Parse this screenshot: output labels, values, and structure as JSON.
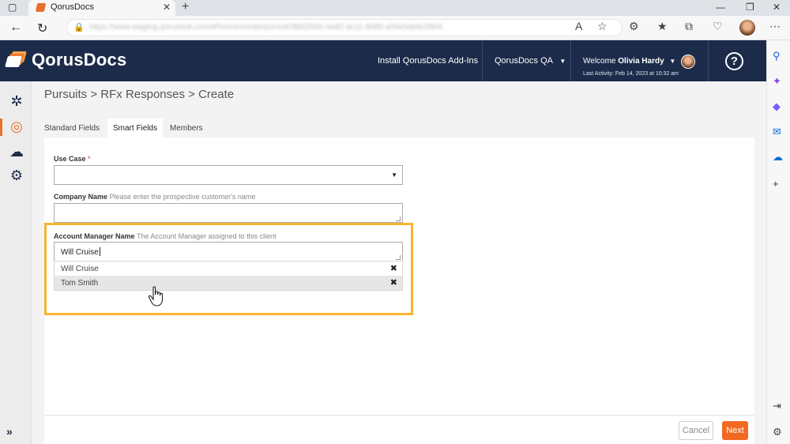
{
  "browser": {
    "tab_title": "QorusDocs",
    "url": "https://www.staging.qorushub.com/#/home/create/pursuit/38d1f00e-4a82-ac11-9085-a55e5ab8c0804"
  },
  "header": {
    "brand": "QorusDocs",
    "install_link": "Install QorusDocs Add-Ins",
    "workspace": "QorusDocs QA",
    "welcome_prefix": "Welcome",
    "user_name": "Olivia Hardy",
    "last_activity": "Last Activity: Feb 14, 2023 at 10:32 am",
    "help": "?"
  },
  "breadcrumb": "Pursuits > RFx Responses > Create",
  "tabs": [
    {
      "label": "Standard Fields"
    },
    {
      "label": "Smart Fields"
    },
    {
      "label": "Members"
    }
  ],
  "form": {
    "use_case": {
      "label": "Use Case",
      "required_mark": "*",
      "value": ""
    },
    "company_name": {
      "label": "Company Name",
      "hint": "Please enter the prospective customer's name",
      "value": ""
    },
    "account_manager": {
      "label": "Account Manager Name",
      "hint": "The Account Manager assigned to this client",
      "value": "Will Cruise",
      "suggestions": [
        "Will Cruise",
        "Tom Smith"
      ]
    }
  },
  "footer": {
    "cancel": "Cancel",
    "next": "Next"
  },
  "colors": {
    "header_bg": "#1c2b4a",
    "accent": "#f26a22",
    "highlight": "#f5b530"
  }
}
